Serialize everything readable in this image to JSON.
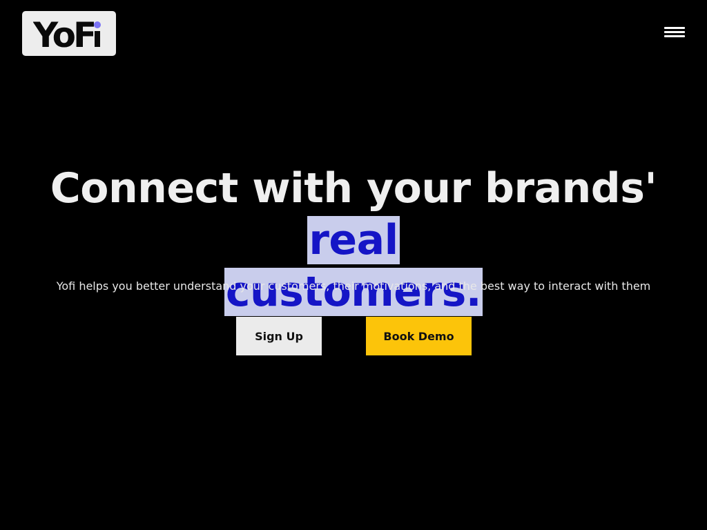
{
  "logo": {
    "text_main": "YoF",
    "text_i": "i",
    "dot_color": "#7b73f5"
  },
  "header": {
    "menu_icon": "hamburger-menu-icon"
  },
  "hero": {
    "title_plain": "Connect with your brands' ",
    "title_highlight_1": "real",
    "title_highlight_2": "customers.",
    "subtitle": "Yofi helps you better understand your customers, their motivations, and the best way to interact with them",
    "highlight_bg": "#c9cdec",
    "highlight_color": "#1515c6"
  },
  "buttons": {
    "signup_label": "Sign Up",
    "demo_label": "Book Demo",
    "demo_color": "#fcc40a"
  }
}
